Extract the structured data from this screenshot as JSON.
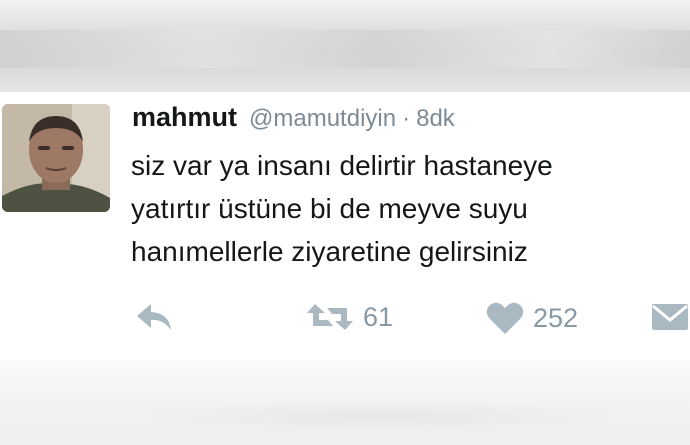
{
  "tweet": {
    "author_name": "mahmut",
    "handle": "@mamutdiyin",
    "separator": "·",
    "time": "8dk",
    "lines": [
      "siz var ya insanı delirtir hastaneye",
      "yatırtır üstüne bi de meyve suyu",
      "hanımellerle ziyaretine gelirsiniz"
    ],
    "retweet_count": "61",
    "like_count": "252"
  },
  "icons": {
    "reply": "reply-icon",
    "retweet": "retweet-icon",
    "like": "heart-icon",
    "dm": "envelope-icon"
  },
  "colors": {
    "text": "#14171a",
    "secondary": "#7c8a96",
    "icon": "#aab8c2"
  }
}
